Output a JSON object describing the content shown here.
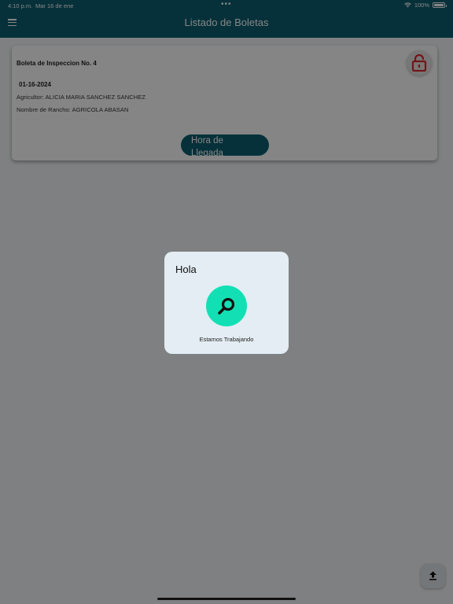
{
  "status_bar": {
    "time": "4:10 p.m.",
    "date": "Mar 16 de ene",
    "dots": "•••",
    "battery": "100%",
    "battery_level": 1.0
  },
  "header": {
    "title": "Listado de Boletas",
    "menu_icon": "menu-icon",
    "color": "#0c5f70"
  },
  "card": {
    "title": "Boleta de Inspeccion No. 4",
    "date": "01-16-2024",
    "farmer": "Agricultor: ALICIA MARIA SANCHEZ SANCHEZ",
    "ranch": "Nombre de Rancho: AGRICOLA ABASAN",
    "arrival_button": "Hora de Llegada",
    "lock_icon": "lock-open-icon",
    "lock_color": "#e0262b"
  },
  "dialog": {
    "title": "Hola",
    "message": "Estamos Trabajando",
    "icon": "search-icon",
    "icon_bg": "#12e0b4"
  },
  "fab": {
    "icon": "upload-icon"
  }
}
